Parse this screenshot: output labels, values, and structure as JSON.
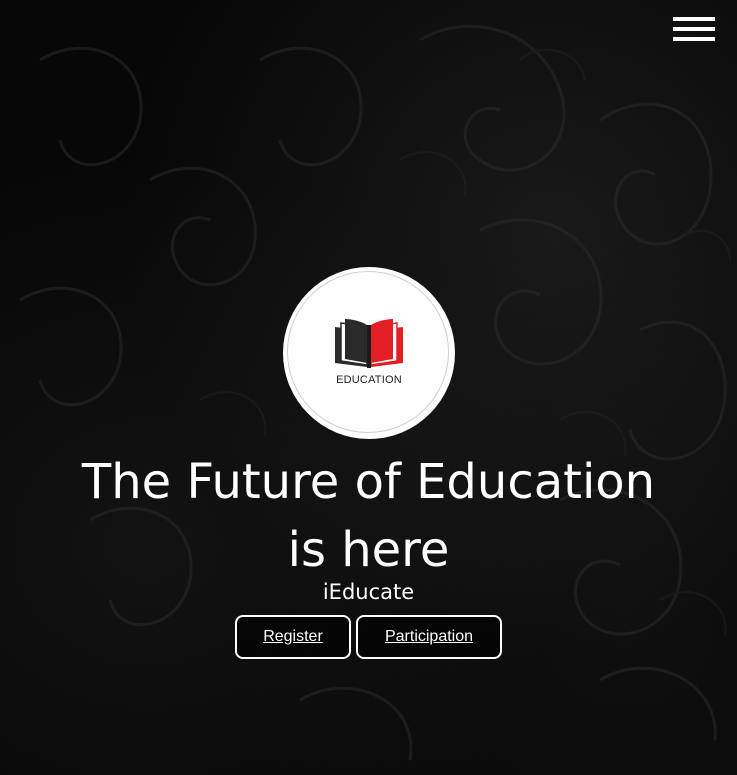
{
  "nav": {
    "menu_icon": "hamburger-menu-icon"
  },
  "logo": {
    "icon": "open-book-icon",
    "text": "EDUCATION",
    "colors": {
      "book_left": "#222222",
      "book_right": "#e31e24"
    }
  },
  "hero": {
    "headline": "The Future of Education is here",
    "subtitle": "iEducate"
  },
  "actions": {
    "register_label": "Register",
    "participation_label": "Participation"
  },
  "colors": {
    "background": "#070707",
    "text": "#ffffff",
    "accent": "#e31e24"
  }
}
